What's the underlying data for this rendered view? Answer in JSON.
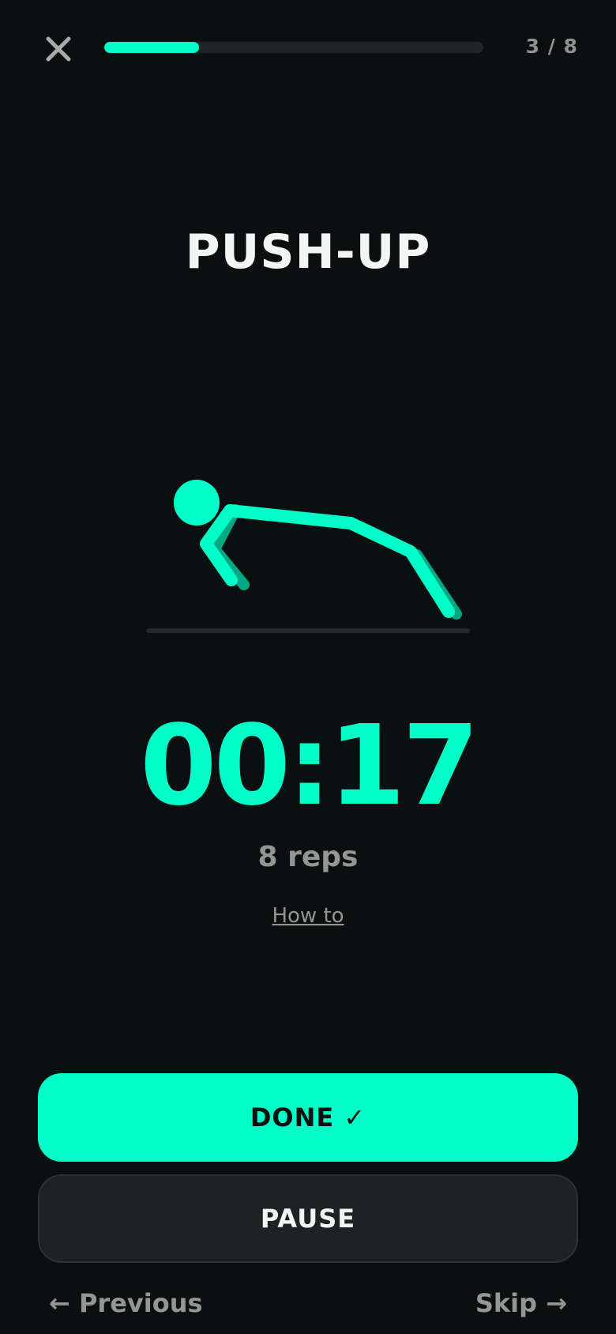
{
  "header": {
    "close_icon": "close-icon",
    "progress": {
      "current": 3,
      "total": 8,
      "fraction": 0.25
    },
    "step_label": "3 / 8"
  },
  "exercise": {
    "name": "PUSH-UP",
    "illustration": "push-up-figure-icon",
    "timer": "00:17",
    "reps": "8 reps",
    "howto_label": "How to"
  },
  "actions": {
    "done_label": "DONE ✓",
    "pause_label": "PAUSE",
    "previous_label": "← Previous",
    "skip_label": "Skip →"
  },
  "colors": {
    "accent": "#00ffc8",
    "background": "#0a100f",
    "muted_text": "#8f9895"
  }
}
